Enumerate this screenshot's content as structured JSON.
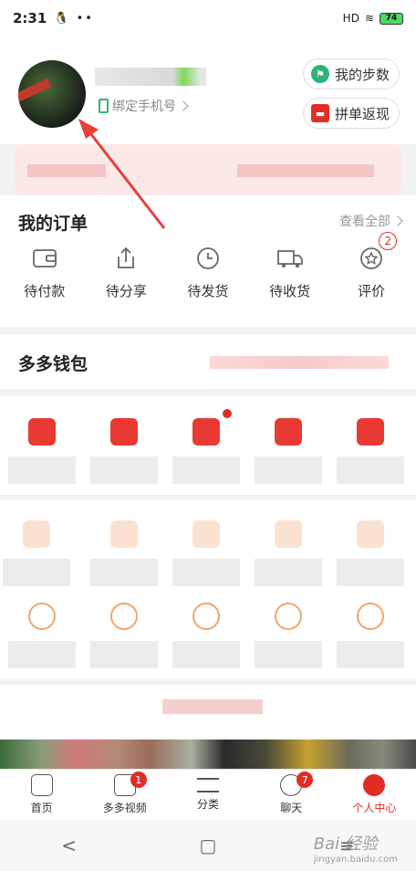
{
  "status_bar": {
    "time": "2:31",
    "left_icons": "🐧 ••",
    "net": "HD",
    "battery": "74"
  },
  "header": {
    "bind_phone": "绑定手机号",
    "steps_label": "我的步数",
    "group_label": "拼单返现"
  },
  "orders": {
    "title": "我的订单",
    "view_all": "查看全部",
    "items": [
      {
        "label": "待付款",
        "icon": "wallet-icon"
      },
      {
        "label": "待分享",
        "icon": "share-icon"
      },
      {
        "label": "待发货",
        "icon": "clock-icon"
      },
      {
        "label": "待收货",
        "icon": "truck-icon"
      },
      {
        "label": "评价",
        "icon": "review-icon",
        "badge": "2"
      }
    ]
  },
  "wallet": {
    "title": "多多钱包"
  },
  "tabbar": {
    "items": [
      {
        "label": "首页",
        "icon": "home-icon"
      },
      {
        "label": "多多视频",
        "icon": "video-icon",
        "badge": "1"
      },
      {
        "label": "分类",
        "icon": "category-icon"
      },
      {
        "label": "聊天",
        "icon": "chat-icon",
        "badge": "7"
      },
      {
        "label": "个人中心",
        "icon": "profile-icon",
        "active": true
      }
    ]
  },
  "navbar": {
    "back": "<",
    "home": "▢",
    "menu": "≡"
  },
  "watermark": {
    "main": "Bai 经验",
    "sub": "jingyan.baidu.com"
  },
  "colors": {
    "accent": "#e02e24",
    "steps": "#2fb37d"
  }
}
